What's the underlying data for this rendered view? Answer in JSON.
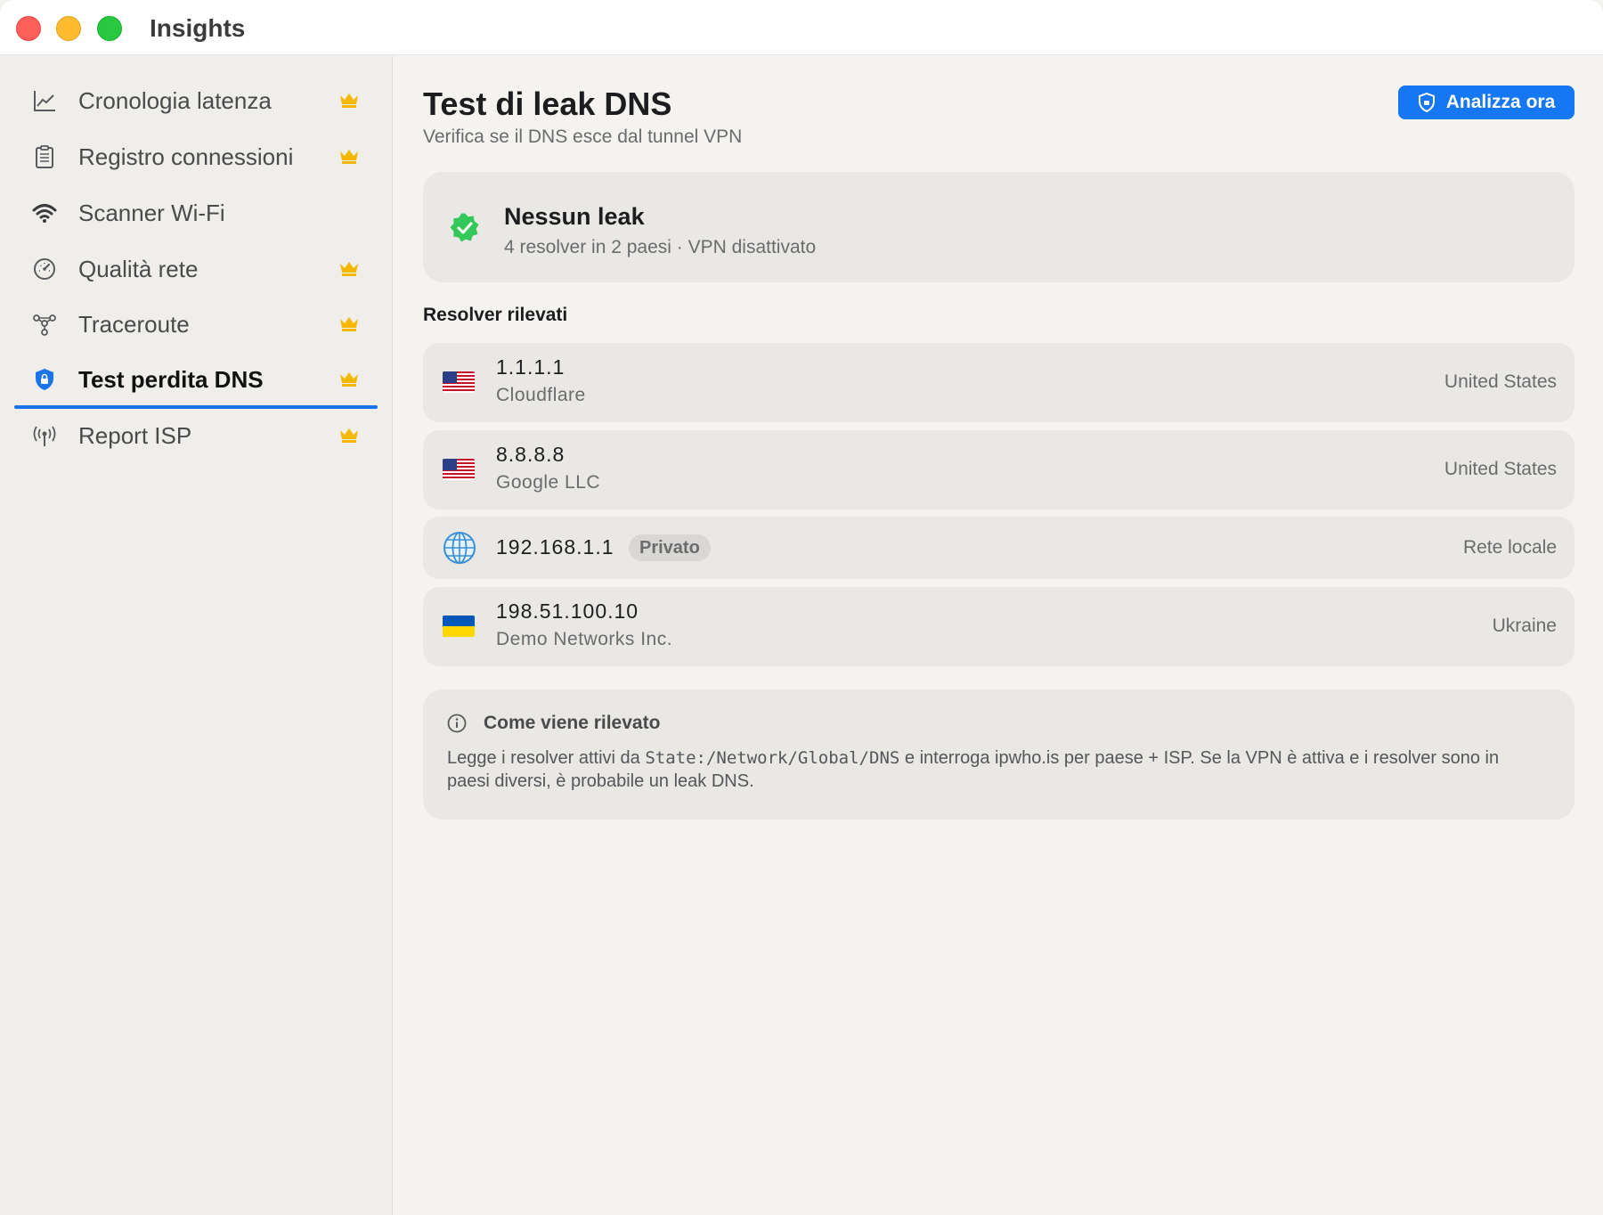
{
  "window": {
    "title": "Insights"
  },
  "sidebar": {
    "items": [
      {
        "label": "Cronologia latenza",
        "icon": "chart-line-icon",
        "premium": true
      },
      {
        "label": "Registro connessioni",
        "icon": "clipboard-icon",
        "premium": true
      },
      {
        "label": "Scanner Wi-Fi",
        "icon": "wifi-icon",
        "premium": false
      },
      {
        "label": "Qualità rete",
        "icon": "gauge-icon",
        "premium": true
      },
      {
        "label": "Traceroute",
        "icon": "network-nodes-icon",
        "premium": true
      },
      {
        "label": "Test perdita DNS",
        "icon": "shield-lock-icon",
        "premium": true,
        "active": true
      },
      {
        "label": "Report ISP",
        "icon": "antenna-icon",
        "premium": true
      }
    ]
  },
  "main": {
    "title": "Test di leak DNS",
    "subtitle": "Verifica se il DNS esce dal tunnel VPN",
    "scan_button": "Analizza ora",
    "status": {
      "title": "Nessun leak",
      "subtitle": "4 resolver in 2 paesi · VPN disattivato"
    },
    "resolvers_title": "Resolver rilevati",
    "resolvers": [
      {
        "ip": "1.1.1.1",
        "isp": "Cloudflare",
        "country": "United States",
        "flag": "us-flag-icon"
      },
      {
        "ip": "8.8.8.8",
        "isp": "Google LLC",
        "country": "United States",
        "flag": "us-flag-icon"
      },
      {
        "ip": "192.168.1.1",
        "badge": "Privato",
        "country": "Rete locale",
        "flag": "globe-icon"
      },
      {
        "ip": "198.51.100.10",
        "isp": "Demo Networks Inc.",
        "country": "Ukraine",
        "flag": "ukraine-flag-icon"
      }
    ],
    "info": {
      "title": "Come viene rilevato",
      "text_before": "Legge i resolver attivi da ",
      "text_code": "State:/Network/Global/DNS",
      "text_after": " e interroga ipwho.is per paese + ISP. Se la VPN è attiva e i resolver sono in paesi diversi, è probabile un leak DNS."
    }
  },
  "colors": {
    "accent": "#1677f2",
    "success": "#34c759",
    "crown": "#f5b800",
    "close": "#ff5f57",
    "minimize": "#febc2e",
    "maximize": "#28c840"
  }
}
